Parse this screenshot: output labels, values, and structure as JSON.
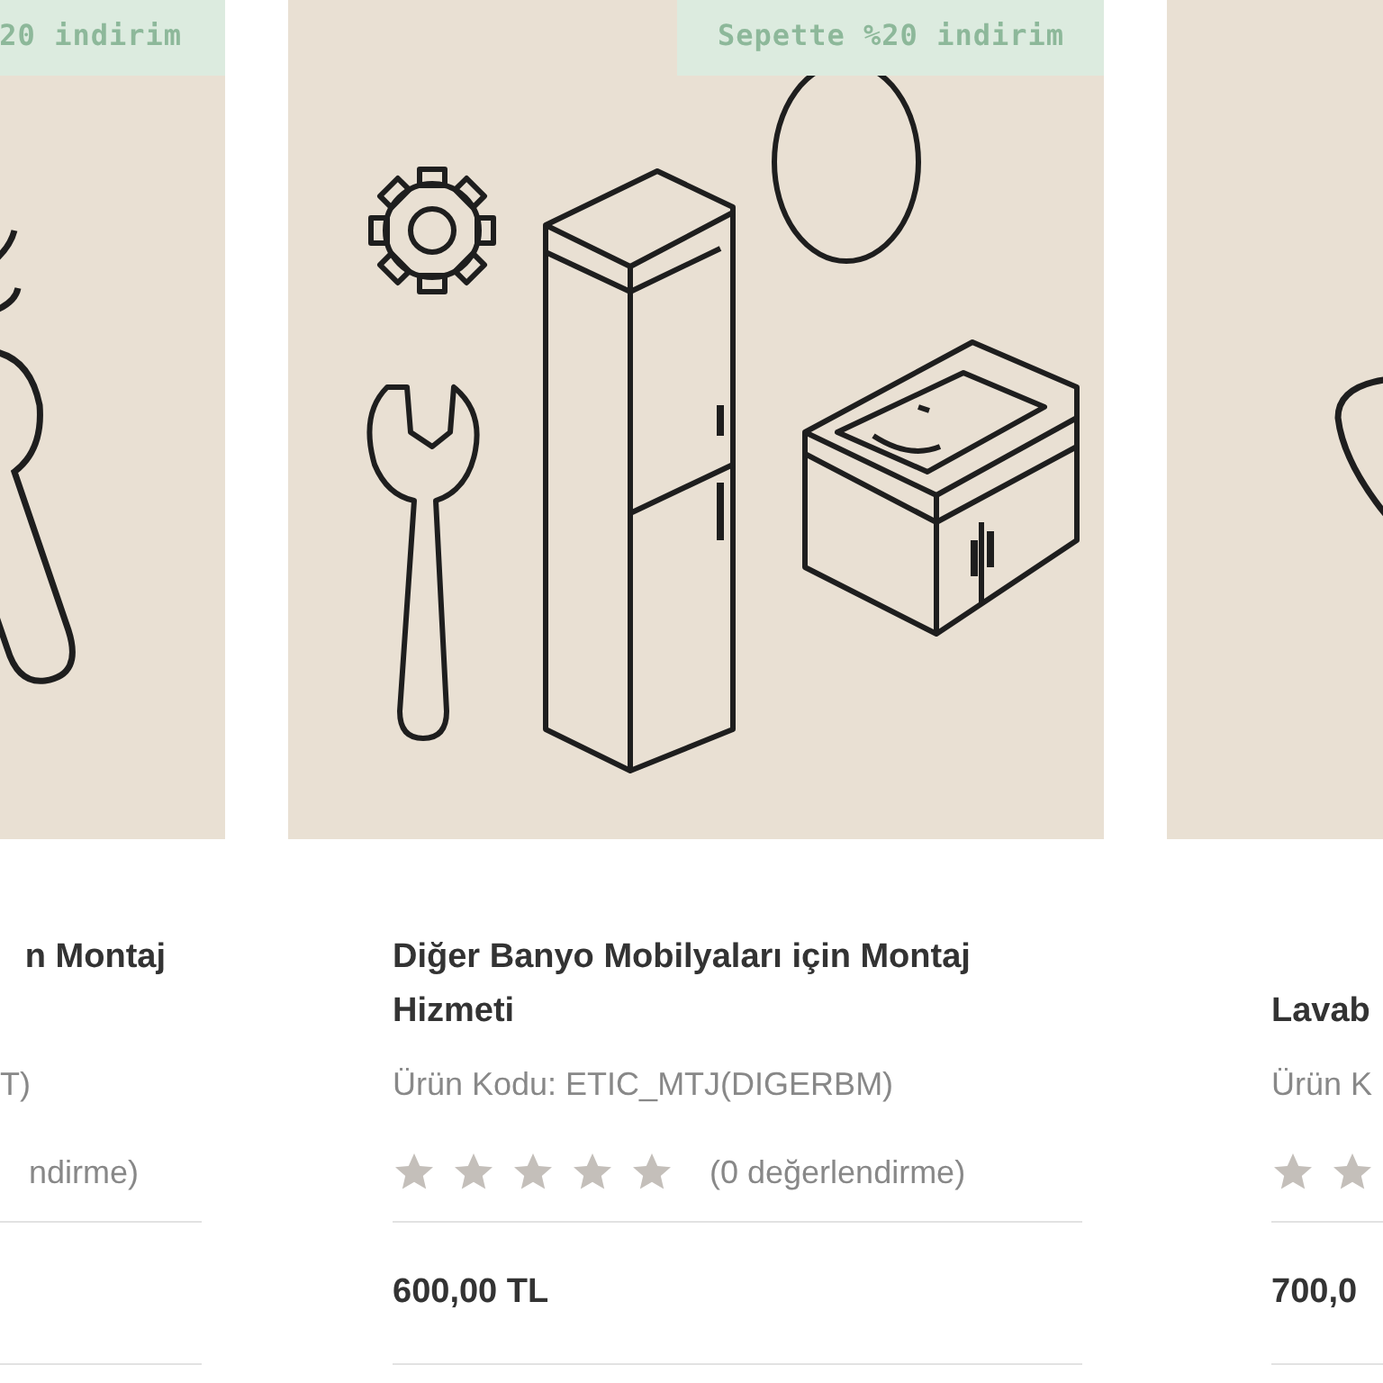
{
  "products": [
    {
      "badge": "20 indirim",
      "title": "n Montaj",
      "code": "T)",
      "rating_text": "ndirme)"
    },
    {
      "badge": "Sepette %20 indirim",
      "title": "Diğer Banyo Mobilyaları için Montaj Hizmeti",
      "code": "Ürün Kodu: ETIC_MTJ(DIGERBM)",
      "stars": 0,
      "rating_text": "(0 değerlendirme)",
      "price": "600,00 TL"
    },
    {
      "title": "Lavab",
      "code": "Ürün K",
      "price": "700,0"
    }
  ]
}
